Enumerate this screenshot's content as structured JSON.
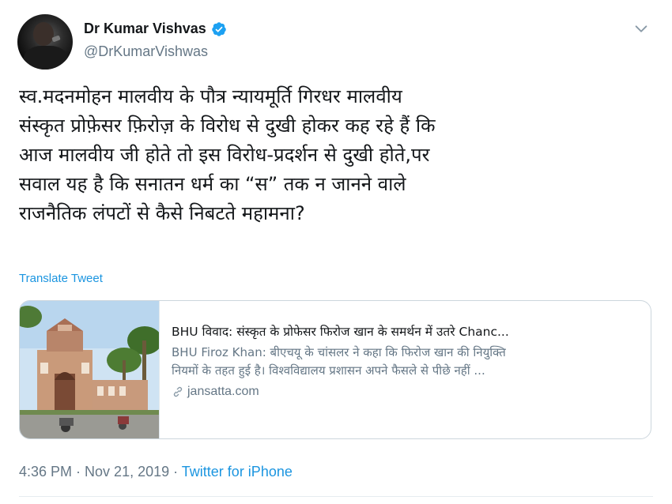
{
  "author": {
    "name": "Dr Kumar Vishvas",
    "handle": "@DrKumarVishwas",
    "verified": true
  },
  "tweet": {
    "lines": [
      "स्व.मदनमोहन मालवीय के पौत्र न्यायमूर्ति गिरधर मालवीय",
      "संस्कृत प्रोफ़ेसर फ़िरोज़ के विरोध से दुखी होकर कह रहे हैं कि",
      "आज मालवीय जी होते तो इस विरोध-प्रदर्शन से दुखी होते,पर",
      "सवाल यह है कि सनातन धर्म का “स” तक न जानने वाले",
      "राजनैतिक लंपटों से कैसे निबटते महामना?"
    ],
    "translate_label": "Translate Tweet"
  },
  "card": {
    "title": "BHU विवाद: संस्कृत के प्रोफेसर फिरोज खान के समर्थन में उतरे Chanc...",
    "description_lines": [
      "BHU Firoz Khan: बीएचयू के चांसलर ने कहा कि फिरोज खान की नियुक्ति",
      "नियमों के तहत हुई है। विश्वविद्यालय प्रशासन अपने फैसले से पीछे नहीं ..."
    ],
    "domain": "jansatta.com"
  },
  "footer": {
    "time": "4:36 PM",
    "separator": " · ",
    "date": "Nov 21, 2019",
    "source": "Twitter for iPhone"
  },
  "icons": {
    "verified": "verified-badge-icon",
    "caret": "chevron-down-icon",
    "link": "link-icon"
  },
  "colors": {
    "link_blue": "#1b95e0",
    "secondary_text": "#657786",
    "border": "#ccd6dd"
  }
}
